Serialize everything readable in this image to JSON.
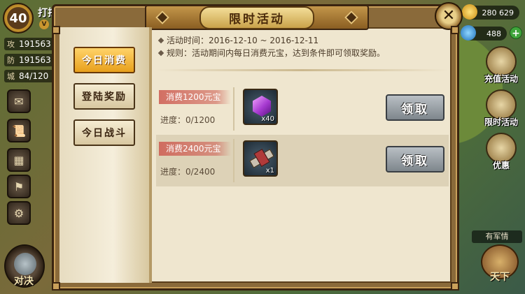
{
  "hud": {
    "level": "40",
    "player_name": "打扫",
    "vip_label": "V",
    "stats": [
      {
        "label": "攻",
        "value": "191563"
      },
      {
        "label": "防",
        "value": "191563"
      },
      {
        "label": "城",
        "value": "84/120"
      }
    ],
    "gold": "280 629",
    "gems": "488",
    "right_buttons": [
      {
        "label": "充值活动"
      },
      {
        "label": "限时活动"
      },
      {
        "label": "优惠"
      }
    ],
    "military_text": "有军情",
    "world_label": "天下",
    "duel_label": "对决"
  },
  "panel": {
    "title": "限时活动",
    "tabs": [
      {
        "label": "今日消费",
        "active": true
      },
      {
        "label": "登陆奖励",
        "active": false
      },
      {
        "label": "今日战斗",
        "active": false
      }
    ],
    "activity_time": "活动时间：2016-12-10 ~ 2016-12-11",
    "rules": "规则：活动期间内每日消费元宝，达到条件即可领取奖励。",
    "rewards": [
      {
        "cost_label": "消费1200元宝",
        "progress": "进度：0/1200",
        "item_icon": "purple-gem-icon",
        "item_count": "x40",
        "claim_label": "领取"
      },
      {
        "cost_label": "消费2400元宝",
        "progress": "进度：0/2400",
        "item_icon": "tool-item-icon",
        "item_count": "x1",
        "claim_label": "领取"
      }
    ]
  }
}
